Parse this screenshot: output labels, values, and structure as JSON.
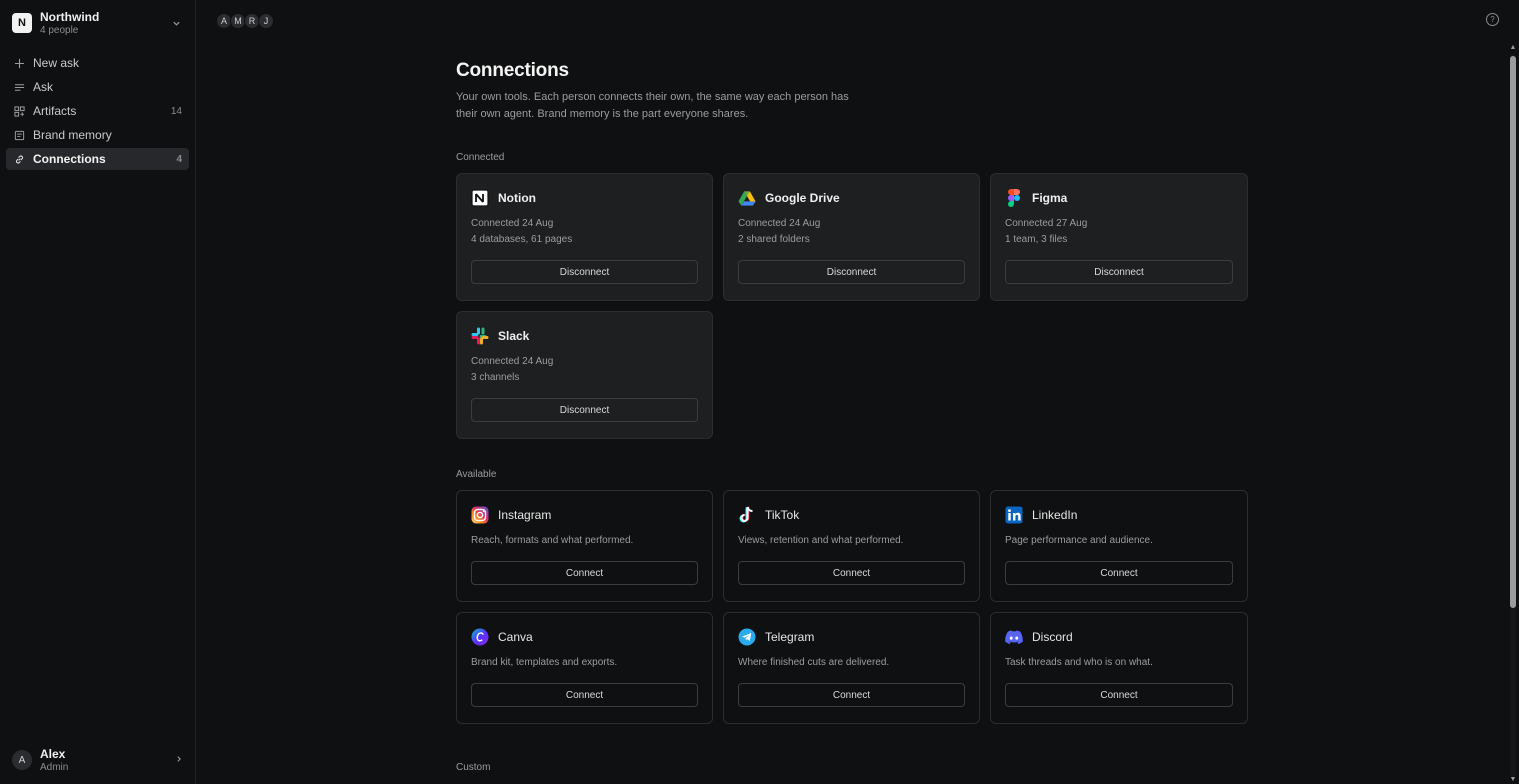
{
  "workspace": {
    "logo_letter": "N",
    "name": "Northwind",
    "subtitle": "4 people"
  },
  "nav": {
    "items": [
      {
        "label": "New ask",
        "count": "",
        "icon": "plus-icon"
      },
      {
        "label": "Ask",
        "count": "",
        "icon": "list-icon"
      },
      {
        "label": "Artifacts",
        "count": "14",
        "icon": "grid-icon"
      },
      {
        "label": "Brand memory",
        "count": "",
        "icon": "book-icon"
      },
      {
        "label": "Connections",
        "count": "4",
        "icon": "link-icon",
        "active": true
      }
    ]
  },
  "user": {
    "initial": "A",
    "name": "Alex",
    "role": "Admin"
  },
  "topbar": {
    "people": [
      "A",
      "M",
      "R",
      "J"
    ],
    "help_icon": "?"
  },
  "page": {
    "title": "Connections",
    "description": "Your own tools. Each person connects their own, the same way each person has their own agent. Brand memory is the part everyone shares."
  },
  "connected": {
    "label": "Connected",
    "cards": [
      {
        "name": "Notion",
        "line1": "Connected 24 Aug",
        "line2": "4 databases, 61 pages",
        "button": "Disconnect",
        "icon": "notion-icon"
      },
      {
        "name": "Google Drive",
        "line1": "Connected 24 Aug",
        "line2": "2 shared folders",
        "button": "Disconnect",
        "icon": "google-drive-icon"
      },
      {
        "name": "Figma",
        "line1": "Connected 27 Aug",
        "line2": "1 team, 3 files",
        "button": "Disconnect",
        "icon": "figma-icon"
      },
      {
        "name": "Slack",
        "line1": "Connected 24 Aug",
        "line2": "3 channels",
        "button": "Disconnect",
        "icon": "slack-icon"
      }
    ]
  },
  "available": {
    "label": "Available",
    "cards": [
      {
        "name": "Instagram",
        "desc": "Reach, formats and what performed.",
        "button": "Connect",
        "icon": "instagram-icon"
      },
      {
        "name": "TikTok",
        "desc": "Views, retention and what performed.",
        "button": "Connect",
        "icon": "tiktok-icon"
      },
      {
        "name": "LinkedIn",
        "desc": "Page performance and audience.",
        "button": "Connect",
        "icon": "linkedin-icon"
      },
      {
        "name": "Canva",
        "desc": "Brand kit, templates and exports.",
        "button": "Connect",
        "icon": "canva-icon"
      },
      {
        "name": "Telegram",
        "desc": "Where finished cuts are delivered.",
        "button": "Connect",
        "icon": "telegram-icon"
      },
      {
        "name": "Discord",
        "desc": "Task threads and who is on what.",
        "button": "Connect",
        "icon": "discord-icon"
      }
    ]
  },
  "custom": {
    "label": "Custom"
  },
  "colors": {
    "background": "#0f1011",
    "card_connected": "#1e1f21",
    "border": "#2b2d30",
    "accent_text": "#f0f0f0"
  }
}
